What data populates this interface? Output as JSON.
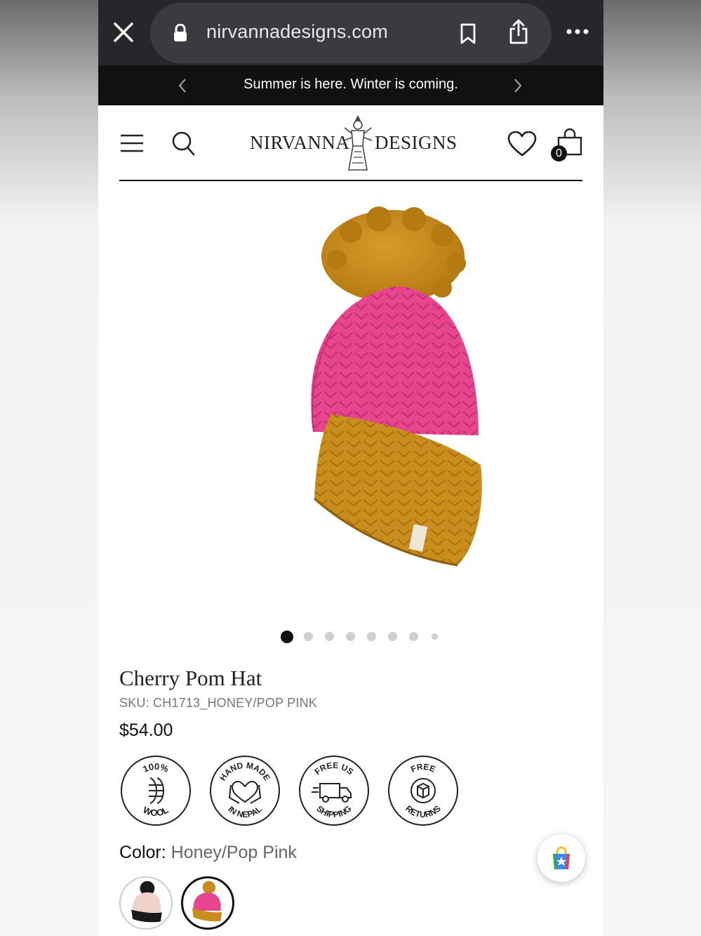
{
  "browser": {
    "url": "nirvannadesigns.com",
    "icons": [
      "close-icon",
      "lock-icon",
      "bookmark-icon",
      "share-icon",
      "more-icon"
    ]
  },
  "announcement": {
    "text": "Summer is here. Winter is coming."
  },
  "header": {
    "logo_left": "NIRVANNA",
    "logo_right": "DESIGNS",
    "cart_count": "0"
  },
  "gallery": {
    "total_images": 8,
    "active_index": 0
  },
  "product": {
    "title": "Cherry Pom Hat",
    "sku": "SKU: CH1713_HONEY/POP PINK",
    "price": "$54.00",
    "badges": [
      {
        "top": "100%",
        "bottom": "WOOL"
      },
      {
        "top": "HAND MADE",
        "bottom": "IN NEPAL"
      },
      {
        "top": "FREE US",
        "bottom": "SHIPPING"
      },
      {
        "top": "FREE",
        "bottom": "RETURNS"
      }
    ],
    "color_label": "Color:",
    "color_value": "Honey/Pop Pink"
  },
  "colors": {
    "pink": "#e7468f",
    "mustard": "#c98d1e",
    "blush": "#f1d2c6",
    "black": "#1a1a1a"
  }
}
